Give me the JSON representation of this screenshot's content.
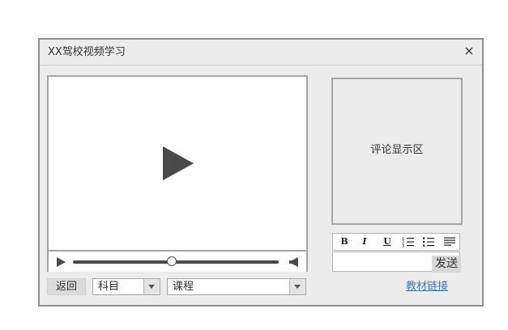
{
  "window": {
    "title": "XX驾校视频学习",
    "close_icon": "close-icon"
  },
  "player": {
    "big_play_icon": "play-icon",
    "small_play_icon": "play-icon",
    "volume_icon": "volume-icon",
    "progress_fraction": 0.48,
    "colors": {
      "controls": "#4a4a4a",
      "screen": "#ffffff"
    }
  },
  "navigation": {
    "back_label": "返回",
    "subject_select": {
      "value": "科目",
      "arrow_icon": "chevron-down-icon"
    },
    "course_select": {
      "value": "课程",
      "arrow_icon": "chevron-down-icon"
    }
  },
  "comments": {
    "placeholder": "评论显示区"
  },
  "editor": {
    "toolbar": {
      "bold": "B",
      "italic": "I",
      "underline": "U",
      "ordered_list_icon": "ordered-list-icon",
      "unordered_list_icon": "unordered-list-icon",
      "align_icon": "align-justify-icon"
    },
    "send_label": "发送"
  },
  "links": {
    "material_label": "教材链接",
    "link_color": "#3a7bc2"
  }
}
